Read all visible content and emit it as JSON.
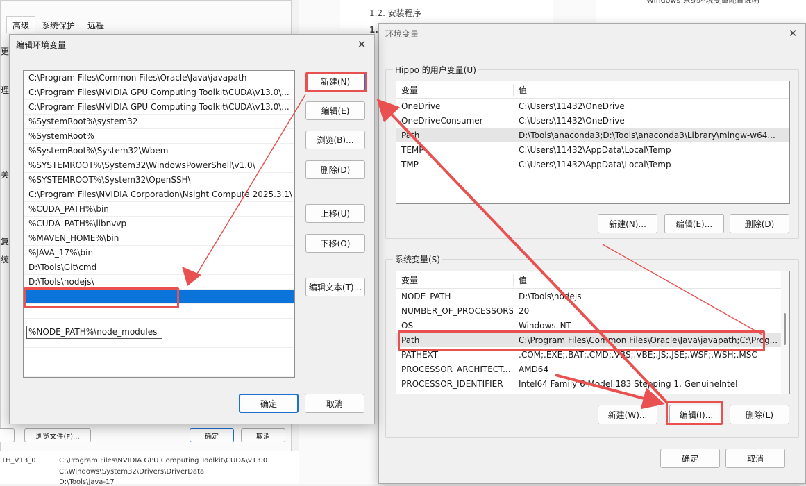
{
  "background": {
    "tabs": [
      "高级",
      "系统保护",
      "远程"
    ],
    "side_fragments": [
      "更改",
      "理",
      "关",
      "复",
      "统"
    ],
    "bottom_buttons": [
      "浏览文件(F)...",
      "确定",
      "取消"
    ],
    "lower_rows": [
      {
        "name": "TH_V13_0",
        "value": "C:\\Program Files\\NVIDIA GPU Computing Toolkit\\CUDA\\v13.0"
      },
      {
        "name": "",
        "value": "C:\\Windows\\System32\\Drivers\\DriverData"
      },
      {
        "name": "",
        "value": "D:\\Tools\\java-17"
      }
    ],
    "doc_heading": "1.2. 安装程序",
    "doc_sub": "1.",
    "right_fragment": "Windows 系统环境变量配置说明"
  },
  "env_dialog": {
    "title": "环境变量",
    "close_glyph": "✕",
    "user_group_label": "Hippo 的用户变量(U)",
    "sys_group_label": "系统变量(S)",
    "col_name": "变量",
    "col_value": "值",
    "user_vars": [
      {
        "name": "OneDrive",
        "value": "C:\\Users\\11432\\OneDrive"
      },
      {
        "name": "OneDriveConsumer",
        "value": "C:\\Users\\11432\\OneDrive"
      },
      {
        "name": "Path",
        "value": "D:\\Tools\\anaconda3;D:\\Tools\\anaconda3\\Library\\mingw-w64..."
      },
      {
        "name": "TEMP",
        "value": "C:\\Users\\11432\\AppData\\Local\\Temp"
      },
      {
        "name": "TMP",
        "value": "C:\\Users\\11432\\AppData\\Local\\Temp"
      }
    ],
    "sys_vars": [
      {
        "name": "NODE_PATH",
        "value": "D:\\Tools\\nodejs"
      },
      {
        "name": "NUMBER_OF_PROCESSORS",
        "value": "20"
      },
      {
        "name": "OS",
        "value": "Windows_NT"
      },
      {
        "name": "Path",
        "value": "C:\\Program Files\\Common Files\\Oracle\\Java\\javapath;C:\\Prog..."
      },
      {
        "name": "PATHEXT",
        "value": ".COM;.EXE;.BAT;.CMD;.VBS;.VBE;.JS;.JSE;.WSF;.WSH;.MSC"
      },
      {
        "name": "PROCESSOR_ARCHITECT...",
        "value": "AMD64"
      },
      {
        "name": "PROCESSOR_IDENTIFIER",
        "value": "Intel64 Family 6 Model 183 Stepping 1, GenuineIntel"
      }
    ],
    "user_buttons": {
      "new": "新建(N)...",
      "edit": "编辑(E)...",
      "delete": "删除(D)"
    },
    "sys_buttons": {
      "new": "新建(W)...",
      "edit": "编辑(I)...",
      "delete": "删除(L)"
    },
    "ok": "确定",
    "cancel": "取消"
  },
  "edit_dialog": {
    "title": "编辑环境变量",
    "close_glyph": "✕",
    "paths": [
      "C:\\Program Files\\Common Files\\Oracle\\Java\\javapath",
      "C:\\Program Files\\NVIDIA GPU Computing Toolkit\\CUDA\\v13.0\\...",
      "C:\\Program Files\\NVIDIA GPU Computing Toolkit\\CUDA\\v13.0\\...",
      "%SystemRoot%\\system32",
      "%SystemRoot%",
      "%SystemRoot%\\System32\\Wbem",
      "%SYSTEMROOT%\\System32\\WindowsPowerShell\\v1.0\\",
      "%SYSTEMROOT%\\System32\\OpenSSH\\",
      "C:\\Program Files\\NVIDIA Corporation\\Nsight Compute 2025.3.1\\",
      "%CUDA_PATH%\\bin",
      "%CUDA_PATH%\\libnvvp",
      "%MAVEN_HOME%\\bin",
      "%JAVA_17%\\bin",
      "D:\\Tools\\Git\\cmd",
      "D:\\Tools\\nodejs\\"
    ],
    "editing_value": "%NODE_PATH%\\node_modules",
    "buttons": {
      "new": "新建(N)",
      "edit": "编辑(E)",
      "browse": "浏览(B)...",
      "delete": "删除(D)",
      "move_up": "上移(U)",
      "move_down": "下移(O)",
      "edit_text": "编辑文本(T)..."
    },
    "ok": "确定",
    "cancel": "取消"
  },
  "colors": {
    "annotation": "#e8514f",
    "selection": "#0a74da",
    "focus_border": "#1f6fd0"
  }
}
